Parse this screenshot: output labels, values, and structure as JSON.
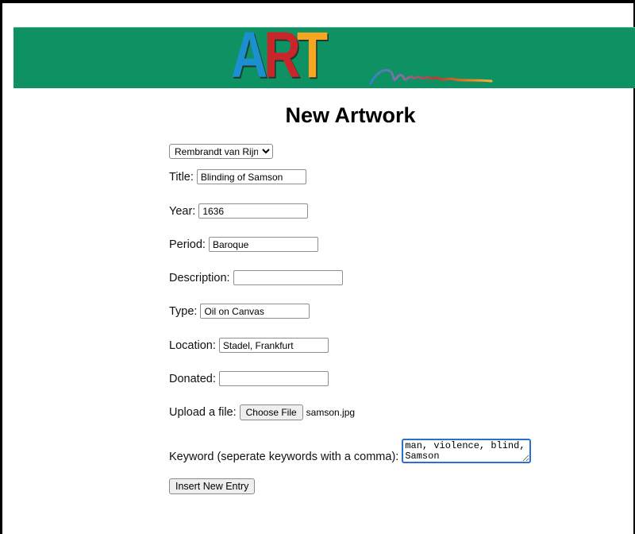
{
  "header": {
    "logo": {
      "letters": [
        {
          "char": "A",
          "color": "#1b8fd0"
        },
        {
          "char": "R",
          "color": "#c9262c"
        },
        {
          "char": "T",
          "color": "#f6a623"
        }
      ],
      "squiggle_colors": [
        "#2f86c7",
        "#8a6fa0",
        "#c0392b",
        "#e67e22",
        "#f5b041"
      ]
    },
    "banner_color": "#0e9163"
  },
  "page_title": "New Artwork",
  "form": {
    "artist_select": {
      "selected": "Rembrandt van Rijn"
    },
    "fields": {
      "title": {
        "label": "Title:",
        "value": "Blinding of Samson",
        "placeholder": ""
      },
      "year": {
        "label": "Year:",
        "value": "1636",
        "placeholder": ""
      },
      "period": {
        "label": "Period:",
        "value": "Baroque",
        "placeholder": ""
      },
      "description": {
        "label": "Description:",
        "value": "",
        "placeholder": ""
      },
      "type": {
        "label": "Type:",
        "value": "Oil on Canvas",
        "placeholder": ""
      },
      "location": {
        "label": "Location:",
        "value": "Stadel, Frankfurt",
        "placeholder": ""
      },
      "donated": {
        "label": "Donated:",
        "value": "",
        "placeholder": ""
      }
    },
    "upload": {
      "label": "Upload a file:",
      "button_label": "Choose File",
      "file_name": "samson.jpg"
    },
    "keywords": {
      "label": "Keyword (seperate keywords with a comma):",
      "value": "man, violence, blind, Samson"
    },
    "submit_label": "Insert New Entry"
  }
}
